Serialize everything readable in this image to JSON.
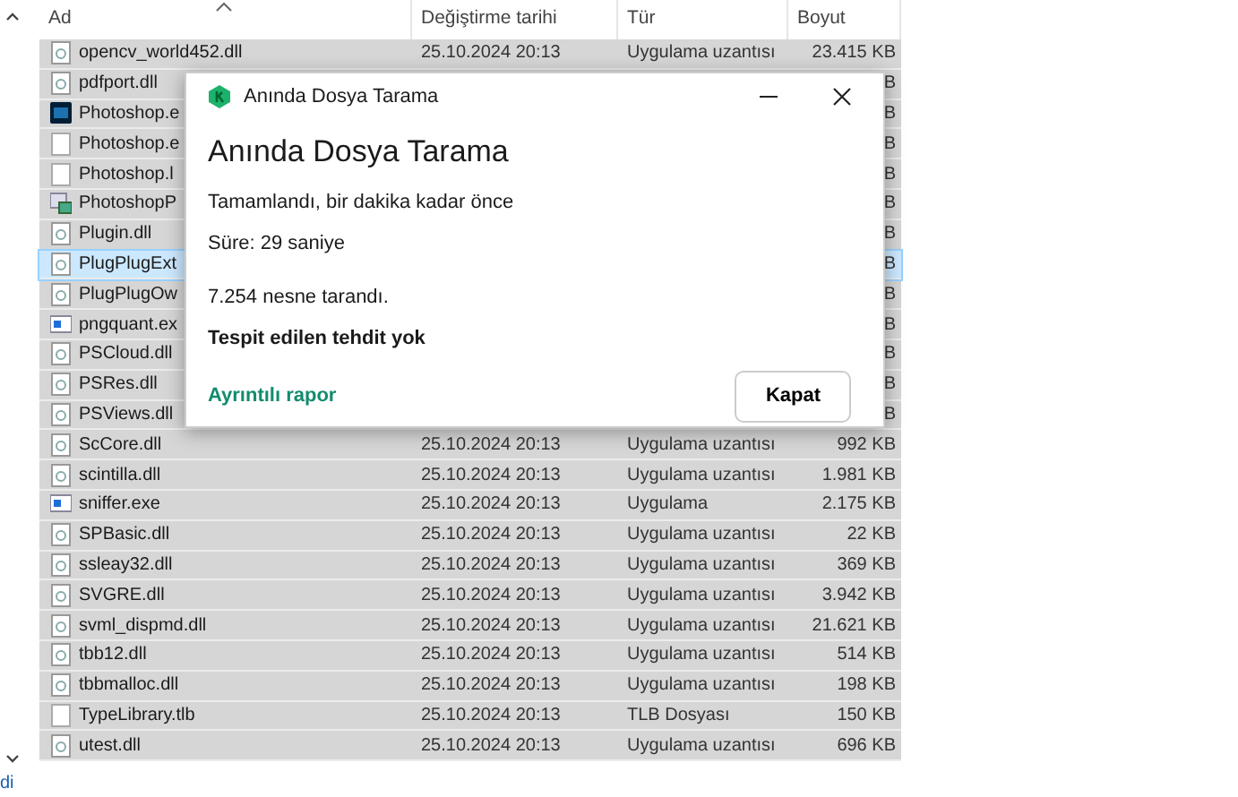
{
  "file_list": {
    "columns": [
      "Ad",
      "Değiştirme tarihi",
      "Tür",
      "Boyut"
    ],
    "rows": [
      {
        "kind": "dll",
        "name": "opencv_world452.dll",
        "date": "25.10.2024 20:13",
        "type": "Uygulama uzantısı",
        "size": "23.415 KB",
        "selected": false
      },
      {
        "kind": "dll",
        "name": "pdfport.dll",
        "size": "B",
        "selected": false
      },
      {
        "kind": "ps",
        "name": "Photoshop.e",
        "size": "B",
        "selected": false
      },
      {
        "kind": "blank",
        "name": "Photoshop.e",
        "size": "B",
        "selected": false
      },
      {
        "kind": "blank",
        "name": "Photoshop.l",
        "size": "B",
        "selected": false
      },
      {
        "kind": "setup",
        "name": "PhotoshopP",
        "size": "B",
        "selected": false
      },
      {
        "kind": "dll",
        "name": "Plugin.dll",
        "size": "B",
        "selected": false
      },
      {
        "kind": "dll",
        "name": "PlugPlugExt",
        "size": "B",
        "selected": true
      },
      {
        "kind": "dll",
        "name": "PlugPlugOw",
        "size": "B",
        "selected": false
      },
      {
        "kind": "exe",
        "name": "pngquant.ex",
        "size": "B",
        "selected": false
      },
      {
        "kind": "dll",
        "name": "PSCloud.dll",
        "size": "B",
        "selected": false
      },
      {
        "kind": "dll",
        "name": "PSRes.dll",
        "size": "B",
        "selected": false
      },
      {
        "kind": "dll",
        "name": "PSViews.dll",
        "size": "B",
        "selected": false
      },
      {
        "kind": "dll",
        "name": "ScCore.dll",
        "date": "25.10.2024 20:13",
        "type": "Uygulama uzantısı",
        "size": "992 KB",
        "selected": false
      },
      {
        "kind": "dll",
        "name": "scintilla.dll",
        "date": "25.10.2024 20:13",
        "type": "Uygulama uzantısı",
        "size": "1.981 KB",
        "selected": false
      },
      {
        "kind": "exe",
        "name": "sniffer.exe",
        "date": "25.10.2024 20:13",
        "type": "Uygulama",
        "size": "2.175 KB",
        "selected": false
      },
      {
        "kind": "dll",
        "name": "SPBasic.dll",
        "date": "25.10.2024 20:13",
        "type": "Uygulama uzantısı",
        "size": "22 KB",
        "selected": false
      },
      {
        "kind": "dll",
        "name": "ssleay32.dll",
        "date": "25.10.2024 20:13",
        "type": "Uygulama uzantısı",
        "size": "369 KB",
        "selected": false
      },
      {
        "kind": "dll",
        "name": "SVGRE.dll",
        "date": "25.10.2024 20:13",
        "type": "Uygulama uzantısı",
        "size": "3.942 KB",
        "selected": false
      },
      {
        "kind": "dll",
        "name": "svml_dispmd.dll",
        "date": "25.10.2024 20:13",
        "type": "Uygulama uzantısı",
        "size": "21.621 KB",
        "selected": false
      },
      {
        "kind": "dll",
        "name": "tbb12.dll",
        "date": "25.10.2024 20:13",
        "type": "Uygulama uzantısı",
        "size": "514 KB",
        "selected": false
      },
      {
        "kind": "dll",
        "name": "tbbmalloc.dll",
        "date": "25.10.2024 20:13",
        "type": "Uygulama uzantısı",
        "size": "198 KB",
        "selected": false
      },
      {
        "kind": "blank",
        "name": "TypeLibrary.tlb",
        "date": "25.10.2024 20:13",
        "type": "TLB Dosyası",
        "size": "150 KB",
        "selected": false
      },
      {
        "kind": "dll",
        "name": "utest.dll",
        "date": "25.10.2024 20:13",
        "type": "Uygulama uzantısı",
        "size": "696 KB",
        "selected": false
      }
    ]
  },
  "nav_pane": {
    "footer_text": "di"
  },
  "dialog": {
    "title": "Anında Dosya Tarama",
    "heading": "Anında Dosya Tarama",
    "status": "Tamamlandı, bir dakika kadar önce",
    "duration": "Süre: 29 saniye",
    "scanned": "7.254 nesne tarandı.",
    "result": "Tespit edilen tehdit yok",
    "link": "Ayrıntılı rapor",
    "button": "Kapat"
  }
}
